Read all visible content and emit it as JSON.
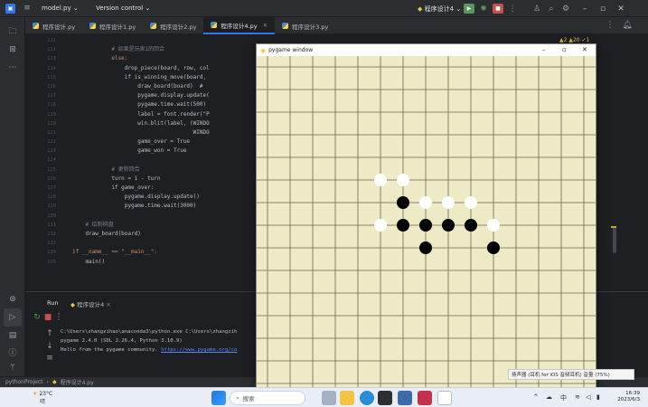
{
  "titlebar": {
    "project": "model.py",
    "vcs": "Version control",
    "run_config": "程序设计4",
    "icons": [
      "menu-icon",
      "run-icon",
      "debug-icon",
      "stop-icon",
      "more-icon",
      "account-icon",
      "search-icon",
      "settings-icon"
    ]
  },
  "tabs": [
    {
      "label": "程序设计.py",
      "active": false
    },
    {
      "label": "程序设计1.py",
      "active": false
    },
    {
      "label": "程序设计2.py",
      "active": false
    },
    {
      "label": "程序设计4.py",
      "active": true
    },
    {
      "label": "程序设计3.py",
      "active": false
    }
  ],
  "editor": {
    "inspections": "▲2 ▲20 ✓1",
    "line_numbers": [
      "111",
      "112",
      "113",
      "114",
      "115",
      "116",
      "117",
      "118",
      "119",
      "120",
      "121",
      "122",
      "123",
      "124",
      "125",
      "126",
      "127",
      "128",
      "129",
      "130",
      "131",
      "132",
      "133",
      "134",
      "135"
    ],
    "lines": [
      {
        "text": "",
        "color": "#bcbec4"
      },
      {
        "text": "            # 如果是玩家1的回合",
        "color": "#7a7e85"
      },
      {
        "text": "            else:",
        "color": "#cf8e6d"
      },
      {
        "text": "                drop_piece(board, row, col",
        "color": "#bcbec4"
      },
      {
        "text": "                if is_winning_move(board,",
        "color": "#bcbec4"
      },
      {
        "text": "                    draw_board(board)  #",
        "color": "#bcbec4"
      },
      {
        "text": "                    pygame.display.update(",
        "color": "#bcbec4"
      },
      {
        "text": "                    pygame.time.wait(500)",
        "color": "#bcbec4"
      },
      {
        "text": "                    label = font.render(\"P",
        "color": "#bcbec4"
      },
      {
        "text": "                    win.blit(label, (WINDO",
        "color": "#bcbec4"
      },
      {
        "text": "                                     WINDO",
        "color": "#bcbec4"
      },
      {
        "text": "                    game_over = True",
        "color": "#bcbec4"
      },
      {
        "text": "                    game_won = True",
        "color": "#bcbec4"
      },
      {
        "text": "",
        "color": "#bcbec4"
      },
      {
        "text": "            # 更新回合",
        "color": "#7a7e85"
      },
      {
        "text": "            turn = 1 - turn",
        "color": "#bcbec4"
      },
      {
        "text": "            if game_over:",
        "color": "#bcbec4"
      },
      {
        "text": "                pygame.display.update()",
        "color": "#bcbec4"
      },
      {
        "text": "                pygame.time.wait(3000)",
        "color": "#bcbec4"
      },
      {
        "text": "",
        "color": "#bcbec4"
      },
      {
        "text": "    # 绘制棋盘",
        "color": "#7a7e85"
      },
      {
        "text": "    draw_board(board)",
        "color": "#bcbec4"
      },
      {
        "text": "",
        "color": "#bcbec4"
      },
      {
        "text": "if __name__ == \"__main__\":",
        "color": "#cf8e6d"
      },
      {
        "text": "    main()",
        "color": "#bcbec4"
      }
    ]
  },
  "run_panel": {
    "tab_label": "Run",
    "config_label": "程序设计4",
    "console_lines": [
      "C:\\Users\\zhangzihao\\anaconda3\\python.exe C:\\Users\\zhangzih",
      "pygame 2.4.0 (SDL 2.26.4, Python 3.10.9)",
      "Hello from the pygame community. "
    ],
    "console_link": "https://www.pygame.org/co"
  },
  "statusbar": {
    "project": "pythonProject",
    "file": "程序设计4.py"
  },
  "pygame_window": {
    "title": "pygame window",
    "board_size": 15,
    "stones": [
      {
        "row": 5,
        "col": 5,
        "color": "white"
      },
      {
        "row": 5,
        "col": 6,
        "color": "white"
      },
      {
        "row": 6,
        "col": 6,
        "color": "black"
      },
      {
        "row": 6,
        "col": 7,
        "color": "white"
      },
      {
        "row": 6,
        "col": 8,
        "color": "white"
      },
      {
        "row": 6,
        "col": 9,
        "color": "white"
      },
      {
        "row": 7,
        "col": 5,
        "color": "white"
      },
      {
        "row": 7,
        "col": 6,
        "color": "black"
      },
      {
        "row": 7,
        "col": 7,
        "color": "black"
      },
      {
        "row": 7,
        "col": 8,
        "color": "black"
      },
      {
        "row": 7,
        "col": 9,
        "color": "black"
      },
      {
        "row": 7,
        "col": 10,
        "color": "white"
      },
      {
        "row": 8,
        "col": 7,
        "color": "black"
      },
      {
        "row": 8,
        "col": 10,
        "color": "black"
      }
    ]
  },
  "tooltip": "扬声器 (耳机 for iOS 音频耳机) 音量 (75%)",
  "taskbar": {
    "weather_temp": "23°C",
    "weather_desc": "晴",
    "search_placeholder": "搜索",
    "time": "16:39",
    "date": "2023/6/3",
    "ime": "中"
  },
  "colors": {
    "ide_bg": "#1e1f22",
    "board_bg": "#efeac6",
    "grid_line": "#6b6650",
    "accent": "#3574f0"
  }
}
